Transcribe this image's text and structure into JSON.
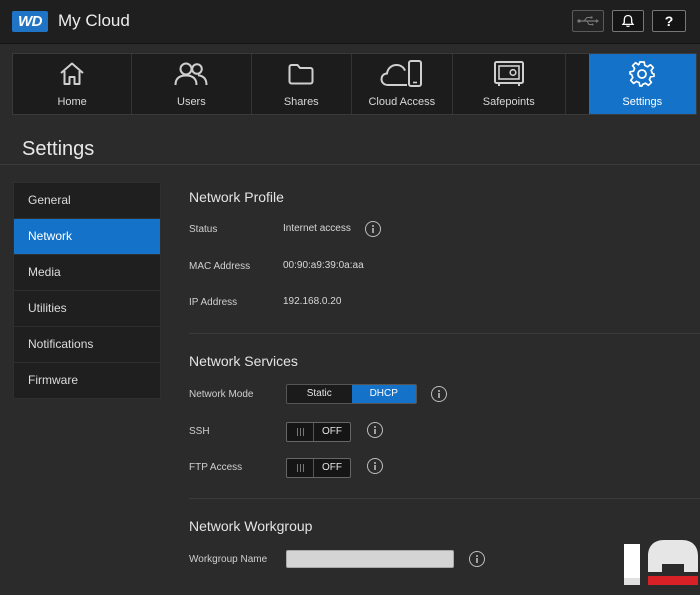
{
  "header": {
    "logo_text": "WD",
    "title": "My Cloud",
    "usb_icon": "usb-icon",
    "bell_icon": "bell-icon",
    "help_label": "?"
  },
  "nav": [
    {
      "label": "Home",
      "icon": "home-icon"
    },
    {
      "label": "Users",
      "icon": "users-icon"
    },
    {
      "label": "Shares",
      "icon": "folder-icon"
    },
    {
      "label": "Cloud Access",
      "icon": "cloud-device-icon"
    },
    {
      "label": "Safepoints",
      "icon": "safe-icon"
    },
    {
      "label": "Settings",
      "icon": "gear-icon",
      "active": true
    }
  ],
  "page_title": "Settings",
  "sidebar": {
    "items": [
      {
        "label": "General"
      },
      {
        "label": "Network",
        "active": true
      },
      {
        "label": "Media"
      },
      {
        "label": "Utilities"
      },
      {
        "label": "Notifications"
      },
      {
        "label": "Firmware"
      }
    ]
  },
  "network_profile": {
    "title": "Network Profile",
    "status_label": "Status",
    "status_value": "Internet access",
    "mac_label": "MAC Address",
    "mac_value": "00:90:a9:39:0a:aa",
    "ip_label": "IP Address",
    "ip_value": "192.168.0.20"
  },
  "network_services": {
    "title": "Network Services",
    "mode_label": "Network Mode",
    "mode_options": [
      "Static",
      "DHCP"
    ],
    "mode_selected": "DHCP",
    "ssh_label": "SSH",
    "ssh_state": "OFF",
    "ftp_label": "FTP Access",
    "ftp_state": "OFF"
  },
  "network_workgroup": {
    "title": "Network Workgroup",
    "name_label": "Workgroup Name",
    "name_value": ""
  },
  "colors": {
    "accent": "#1473c9",
    "background": "#2b2b2b",
    "topbar": "#1f1f1f"
  }
}
